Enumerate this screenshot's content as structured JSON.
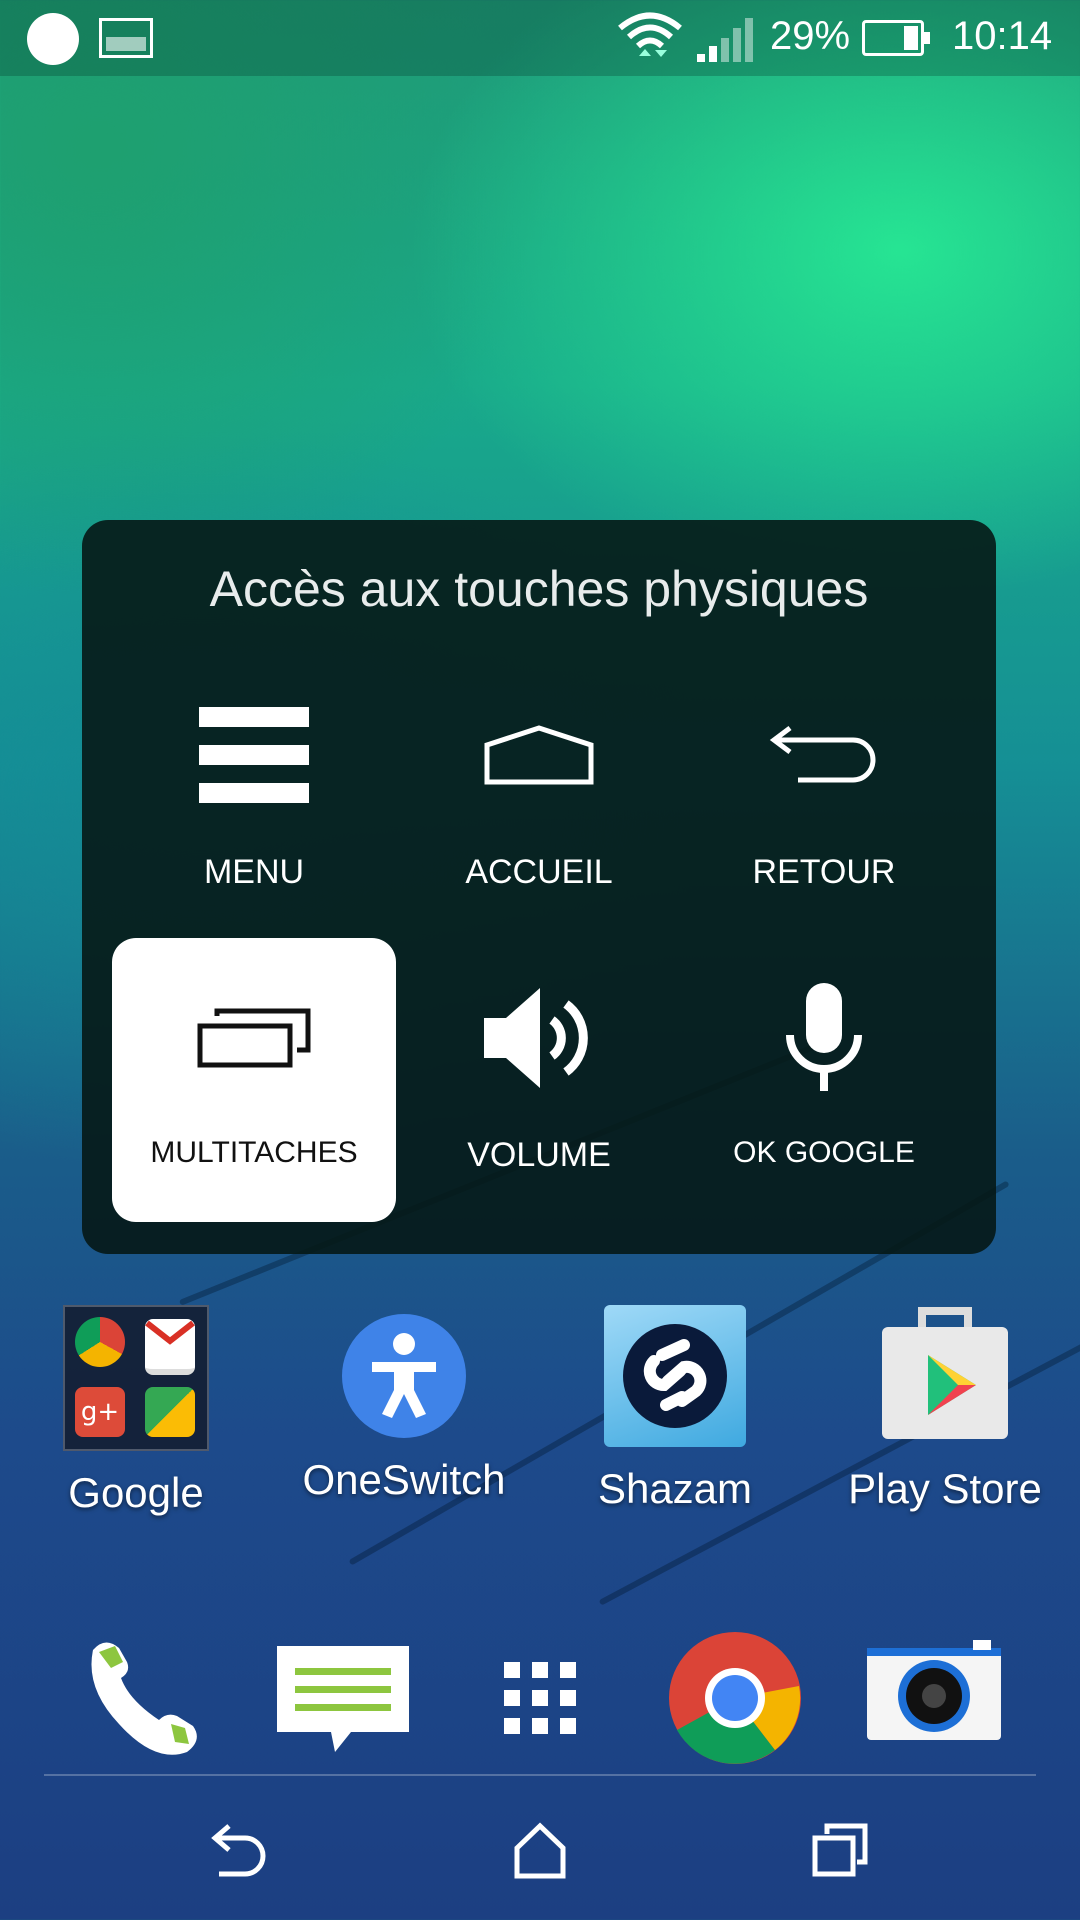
{
  "status_bar": {
    "battery_percent": "29%",
    "time": "10:14",
    "battery_level": 0.29
  },
  "panel": {
    "title": "Accès aux touches physiques",
    "keys": [
      {
        "label": "MENU",
        "icon": "menu-icon",
        "selected": false
      },
      {
        "label": "ACCUEIL",
        "icon": "home-icon",
        "selected": false
      },
      {
        "label": "RETOUR",
        "icon": "back-arrow-icon",
        "selected": false
      },
      {
        "label": "MULTITACHES",
        "icon": "recent-apps-icon",
        "selected": true
      },
      {
        "label": "VOLUME",
        "icon": "speaker-icon",
        "selected": false
      },
      {
        "label": "OK GOOGLE",
        "icon": "microphone-icon",
        "selected": false
      }
    ]
  },
  "apps": [
    {
      "label": "Google",
      "icon": "google-folder-icon"
    },
    {
      "label": "OneSwitch",
      "icon": "accessibility-icon"
    },
    {
      "label": "Shazam",
      "icon": "shazam-icon"
    },
    {
      "label": "Play Store",
      "icon": "play-store-icon"
    }
  ],
  "dock": [
    "phone-icon",
    "messages-icon",
    "app-drawer-icon",
    "chrome-icon",
    "camera-icon"
  ],
  "nav": [
    "nav-back-icon",
    "nav-home-icon",
    "nav-recents-icon"
  ],
  "colors": {
    "accent_green": "#28f096",
    "panel_bg": "#061816",
    "oneswitch_blue": "#3f83e8"
  }
}
